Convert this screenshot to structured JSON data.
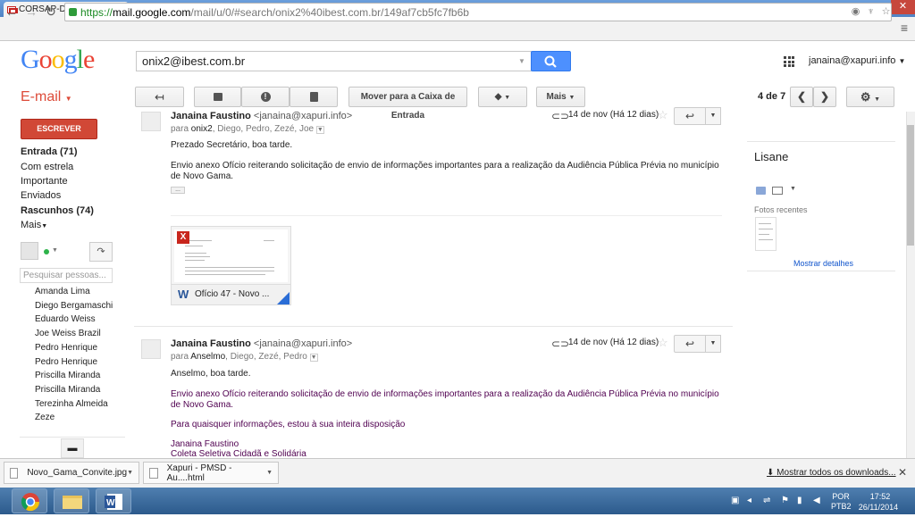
{
  "browser": {
    "tab_title": "CORSAP-DF/GO - Mobiliza",
    "url_secure": "https://",
    "url_domain": "mail.google.com",
    "url_path": "/mail/u/0/#search/onix2%40ibest.com.br/149af7cb5fc7fb6b"
  },
  "header": {
    "logo": "Google",
    "search_value": "onix2@ibest.com.br",
    "account": "janaina@xapuri.info"
  },
  "toolbar": {
    "app_label": "E-mail",
    "move_label": "Mover para a Caixa de Entrada",
    "more_label": "Mais",
    "pager": "4 de 7"
  },
  "nav": {
    "compose": "ESCREVER",
    "items": [
      "Entrada (71)",
      "Com estrela",
      "Importante",
      "Enviados",
      "Rascunhos (74)",
      "Mais"
    ],
    "people_placeholder": "Pesquisar pessoas...",
    "contacts": [
      "Amanda Lima",
      "Diego Bergamaschi",
      "Eduardo Weiss",
      "Joe Weiss Brazil",
      "Pedro Henrique",
      "Pedro Henrique",
      "Priscilla Miranda",
      "Priscilla Miranda",
      "Terezinha Almeida",
      "Zeze"
    ]
  },
  "messages": [
    {
      "sender": "Janaina Faustino",
      "email": "<janaina@xapuri.info>",
      "to_prefix": "para",
      "to_first": "onix2",
      "to_rest": ", Diego, Pedro, Zezé, Joe",
      "date": "14 de nov (Há 12 dias)",
      "greeting": "Prezado Secretário, boa tarde.",
      "body_line1": "Envio anexo Ofício reiterando solicitação de envio de informações importantes para a realização da Audiência Pública Prévia no município",
      "body_line2": "de Novo Gama.",
      "attachment_name": "Ofício 47 - Novo ..."
    },
    {
      "sender": "Janaina Faustino",
      "email": "<janaina@xapuri.info>",
      "to_prefix": "para",
      "to_first": "Anselmo",
      "to_rest": ", Diego, Zezé, Pedro",
      "date": "14 de nov (Há 12 dias)",
      "greeting": "Anselmo, boa tarde.",
      "body_line1": "Envio anexo Ofício reiterando solicitação de envio de informações importantes para a realização da Audiência Pública Prévia no município",
      "body_line2": "de Novo Gama.",
      "body_line3": "Para quaisquer informações, estou à sua inteira disposição",
      "sig1": "Janaina Faustino",
      "sig2": "Coleta Seletiva Cidadã e Solidária"
    }
  ],
  "contact_panel": {
    "name": "Lisane",
    "photos_label": "Fotos recentes",
    "details_link": "Mostrar detalhes"
  },
  "downloads": {
    "items": [
      "Novo_Gama_Convite.jpg",
      "Xapuri - PMSD - Au....html"
    ],
    "show_all": "Mostrar todos os downloads..."
  },
  "taskbar": {
    "lang1": "POR",
    "lang2": "PTB2",
    "time": "17:52",
    "date": "26/11/2014"
  }
}
